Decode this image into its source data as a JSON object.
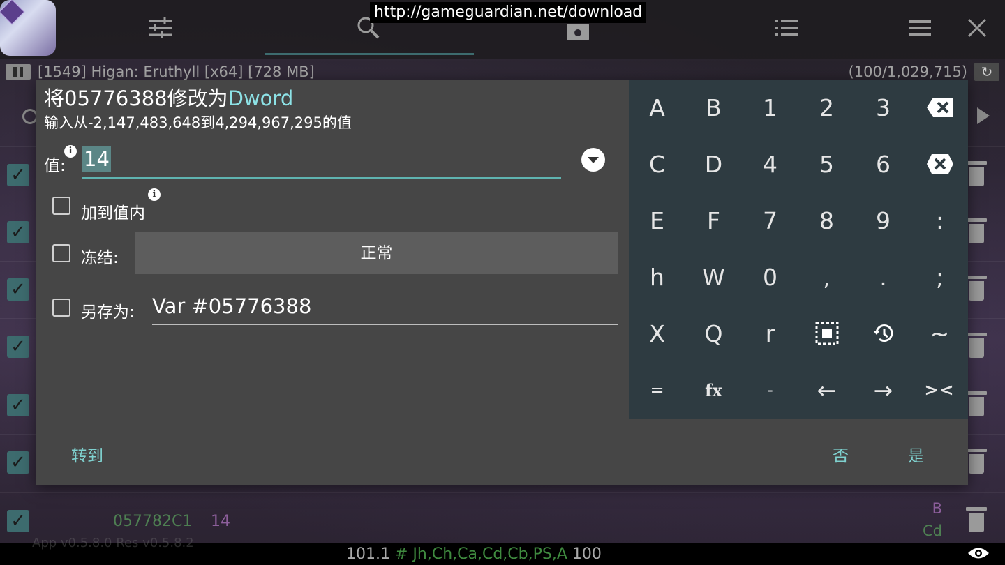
{
  "overlay_url": "http://gameguardian.net/download",
  "process": {
    "label": "[1549] Higan: Eruthyll [x64] [728 MB]",
    "count": "(100/1,029,715)"
  },
  "visible_row": {
    "address": "057782C1",
    "value": "14",
    "type_b": "B",
    "type_cd": "Cd"
  },
  "bottom": {
    "ghost_text": "App v0.5.8.0 Res v0.5.8.2",
    "status_prefix": "101.1",
    "status_hash": "#",
    "status_mid": "Jh,Ch,Ca,Cd,Cb,PS,A",
    "status_suffix": "100"
  },
  "dialog": {
    "title_prefix": "将05776388修改为",
    "title_type": "Dword",
    "subtitle": "输入从-2,147,483,648到4,294,967,295的值",
    "value_label": "值:",
    "value": "14",
    "add_to_value_label": "加到值内",
    "freeze_label": "冻结:",
    "freeze_mode": "正常",
    "save_as_label": "另存为:",
    "save_as_value": "Var #05776388",
    "goto_label": "转到",
    "no_label": "否",
    "yes_label": "是",
    "info_glyph": "i"
  },
  "keyboard": {
    "rows": [
      [
        "A",
        "B",
        "1",
        "2",
        "3",
        "backspace-icon"
      ],
      [
        "C",
        "D",
        "4",
        "5",
        "6",
        "clear-icon"
      ],
      [
        "E",
        "F",
        "7",
        "8",
        "9",
        ":"
      ],
      [
        "h",
        "W",
        "0",
        ",",
        ".",
        ";"
      ],
      [
        "X",
        "Q",
        "r",
        "select-all-icon",
        "history-icon",
        "~"
      ],
      [
        "=",
        "fx",
        "-",
        "←",
        "→",
        "><"
      ]
    ]
  },
  "colors": {
    "accent": "#8de2e6",
    "button_text": "#7fd1cf",
    "underline": "#5fb3b0",
    "dialog_bg": "#464646",
    "keyboard_bg": "#2e3b41",
    "address_green": "#4e7f52",
    "value_purple": "#8d5f9c"
  }
}
